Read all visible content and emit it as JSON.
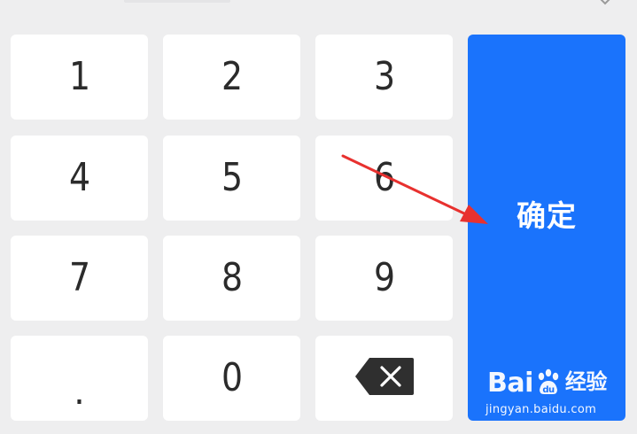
{
  "keypad": {
    "keys": {
      "one": "1",
      "two": "2",
      "three": "3",
      "four": "4",
      "five": "5",
      "six": "6",
      "seven": "7",
      "eight": "8",
      "nine": "9",
      "dot": ".",
      "zero": "0"
    },
    "backspace_icon": "backspace-icon",
    "confirm_label": "确定"
  },
  "header": {
    "collapse_icon": "chevron-down-icon"
  },
  "watermark": {
    "brand_prefix": "Bai",
    "brand_mid": "du",
    "brand_suffix": "经验",
    "url": "jingyan.baidu.com"
  },
  "annotation": {
    "arrow_color": "#e8312f"
  },
  "colors": {
    "background": "#eeeeef",
    "key_background": "#ffffff",
    "key_text": "#2b2b2b",
    "confirm_background": "#1a73fc",
    "confirm_text": "#ffffff"
  }
}
